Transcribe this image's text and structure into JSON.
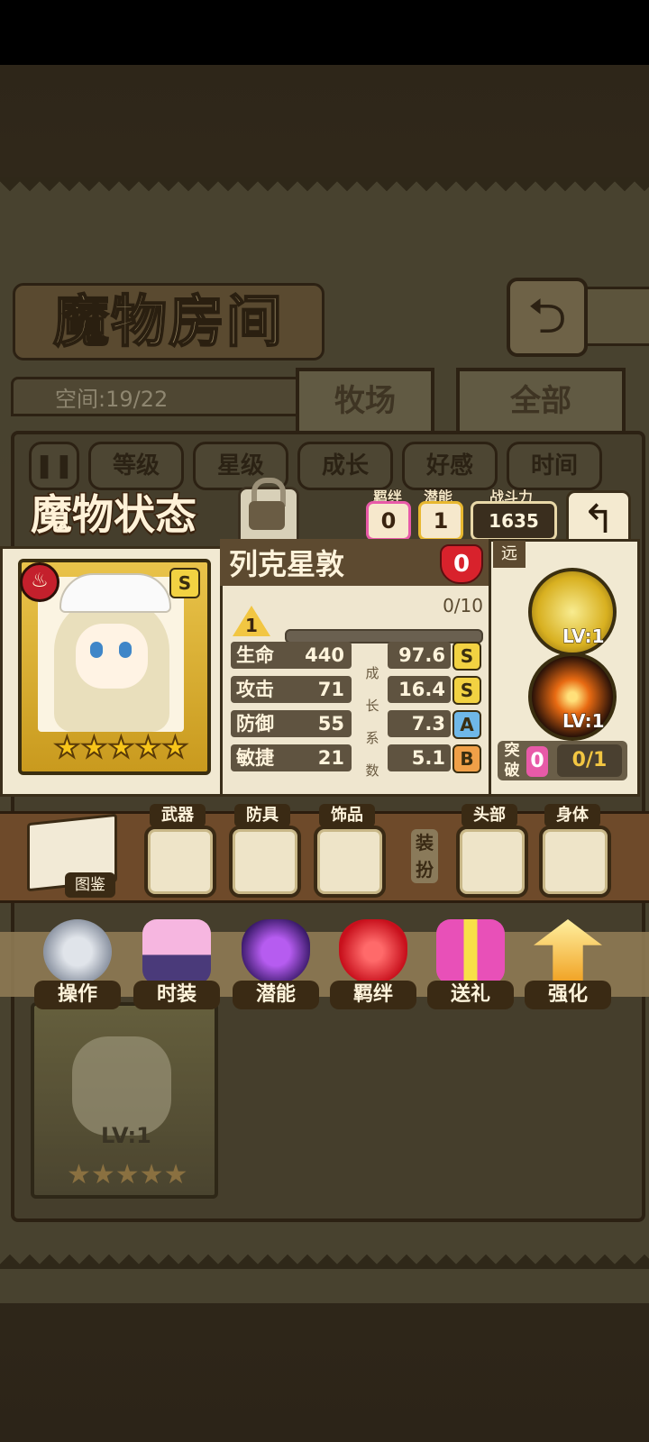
{
  "header": {
    "title": "魔物房间"
  },
  "capacity": "空间:19/22",
  "tabs": [
    {
      "label": "牧场"
    },
    {
      "label": "全部"
    }
  ],
  "sort_buttons": [
    {
      "label": "等级"
    },
    {
      "label": "星级"
    },
    {
      "label": "成长"
    },
    {
      "label": "好感"
    },
    {
      "label": "时间"
    }
  ],
  "status_panel": {
    "title": "魔物状态",
    "bond_label": "羁绊",
    "bond_value": "0",
    "potential_label": "潜能",
    "potential_value": "1",
    "power_label": "战斗力",
    "power_value": "1635"
  },
  "monster": {
    "name": "列克星敦",
    "affection": "0",
    "level": "1",
    "exp": "0/10",
    "exp_progress": 0,
    "rank": "S",
    "stars": 5,
    "stats": [
      {
        "label": "生命",
        "value": "440",
        "growth": "97.6",
        "grade": "S"
      },
      {
        "label": "攻击",
        "value": "71",
        "growth": "16.4",
        "grade": "S"
      },
      {
        "label": "防御",
        "value": "55",
        "growth": "7.3",
        "grade": "A"
      },
      {
        "label": "敏捷",
        "value": "21",
        "growth": "5.1",
        "grade": "B"
      }
    ],
    "growth_caption": [
      "成",
      "长",
      "系",
      "数"
    ]
  },
  "skills": {
    "range": "远",
    "items": [
      {
        "level": "LV:1"
      },
      {
        "level": "LV:1"
      }
    ],
    "breakthrough_label": "突破",
    "breakthrough_value": "0",
    "breakthrough_count": "0/1"
  },
  "equipment": {
    "book_label": "图鉴",
    "dress_label": "装扮",
    "slots": [
      {
        "label": "武器"
      },
      {
        "label": "防具"
      },
      {
        "label": "饰品"
      },
      {
        "label": "头部"
      },
      {
        "label": "身体"
      }
    ]
  },
  "actions": [
    {
      "label": "操作"
    },
    {
      "label": "时装"
    },
    {
      "label": "潜能"
    },
    {
      "label": "羁绊"
    },
    {
      "label": "送礼"
    },
    {
      "label": "强化"
    }
  ],
  "background_card": {
    "level": "LV:1"
  },
  "colors": {
    "grade_S": "#f2d242",
    "grade_A": "#6fb8e8",
    "grade_B": "#f0a048",
    "accent_pink": "#e85aa8"
  }
}
